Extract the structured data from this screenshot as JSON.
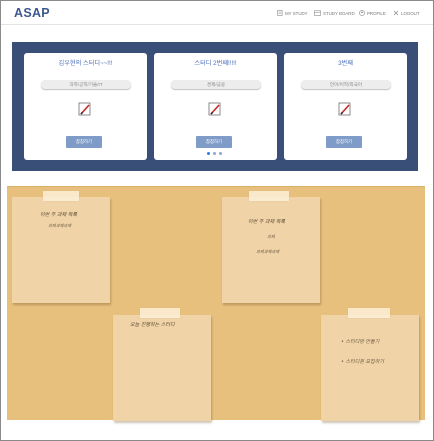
{
  "header": {
    "logo": "ASAP",
    "nav": [
      {
        "label": "MY STUDY",
        "icon": "document-icon"
      },
      {
        "label": "STUDY BOARD",
        "icon": "board-icon"
      },
      {
        "label": "PROFILE",
        "icon": "profile-icon"
      },
      {
        "label": "LOGOUT",
        "icon": "close-icon"
      }
    ]
  },
  "carousel": {
    "cards": [
      {
        "title": "김우현의 스터디~~!!!",
        "category": "과학/공학/기술/IT",
        "join_label": "참참하기"
      },
      {
        "title": "스터디 2번째!!!!!",
        "category": "경제/금융",
        "join_label": "참참하기"
      },
      {
        "title": "3번째",
        "category": "언어/어학/외국어",
        "join_label": "참참하기"
      }
    ],
    "pages": 3,
    "active_page": 0
  },
  "board": {
    "notes": [
      {
        "title": "이번 주 과제 목록",
        "lines": [
          "과제과제과제"
        ]
      },
      {
        "title": "이번 주 과제 목록",
        "lines": [
          "과제",
          "과제과제과제"
        ]
      },
      {
        "title": "오늘 진행하는 스터디",
        "lines": []
      },
      {
        "title": "",
        "lines": [
          "• 스터디방 만들기",
          "• 스터디원 모집하기"
        ]
      }
    ]
  },
  "colors": {
    "brand": "#3d5891",
    "carousel_bg": "#3a4f78",
    "card_title": "#4b6db8",
    "join_button": "#7f9bc7",
    "board_bg": "#e7c07d",
    "note_bg": "#f0d3a6"
  }
}
